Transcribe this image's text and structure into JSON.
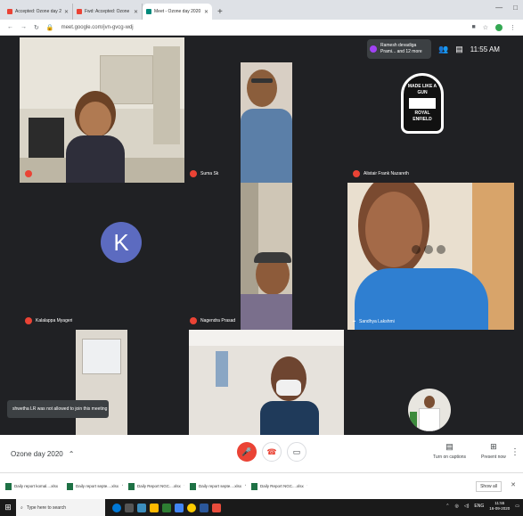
{
  "browser": {
    "tabs": [
      {
        "label": "Accepted: Ozone day 2020 @ W",
        "fav_color": "#ea4335",
        "active": false
      },
      {
        "label": "Fwd: Accepted: Ozone day 202",
        "fav_color": "#ea4335",
        "active": false
      },
      {
        "label": "Meet - Ozone day 2020",
        "fav_color": "#00897b",
        "active": true
      }
    ],
    "new_tab": "+",
    "url": "meet.google.com/jvn-gvcg-wdj",
    "window_controls": [
      "—",
      "□"
    ]
  },
  "meet": {
    "participants_chip": "Ramesh devadiga Prami... and 12 more",
    "clock": "11:55 AM",
    "tiles": [
      {
        "name": ""
      },
      {
        "name": "Suma Sk"
      },
      {
        "name": "Alistair Frank Nazareth"
      },
      {
        "name": "Kalalappa Myageri",
        "initial": "K"
      },
      {
        "name": "Nagendra Prasad"
      },
      {
        "name": "Sandhya Lakshmi"
      },
      {
        "name": ""
      },
      {
        "name": ""
      },
      {
        "name": ""
      }
    ],
    "logo_text": [
      "MADE LIKE A GUN",
      "ROYAL",
      "ENFIELD"
    ],
    "toast": "shwetha LR was not allowed to join this meeting",
    "meeting_title": "Ozone day 2020",
    "captions_label": "Turn on captions",
    "present_label": "Present now"
  },
  "downloads": {
    "items": [
      "Daily report komal....xlsx",
      "Daily report septe....xlsx",
      "Daily Report NGC....xlsx",
      "Daily report septe....xlsx",
      "Daily Report NGC....xlsx"
    ],
    "show_all": "Show all"
  },
  "taskbar": {
    "search_placeholder": "Type here to search",
    "language": "ENG",
    "time": "11:55",
    "date": "16-09-2020",
    "app_colors": [
      "#0078d7",
      "#ffb900",
      "#3c8dbc",
      "#e74c3c",
      "#2e7d32",
      "#ff5722",
      "#4285f4"
    ]
  },
  "icons": {
    "participants": "people-icon",
    "chat": "chat-icon",
    "mic_off": "mic-off-icon",
    "hangup": "hangup-icon",
    "camera": "camera-icon",
    "captions": "captions-icon",
    "present": "present-icon"
  }
}
